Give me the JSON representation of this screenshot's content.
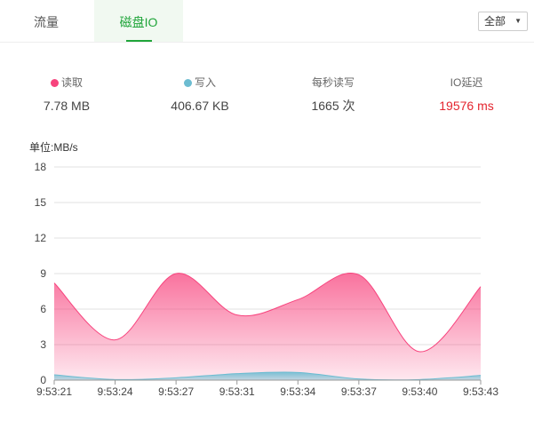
{
  "tabs": {
    "flow": "流量",
    "disk_io": "磁盘IO",
    "active": "disk_io"
  },
  "disk_selector": {
    "value": "全部",
    "caret": "▼"
  },
  "stats": {
    "read": {
      "label": "读取",
      "value": "7.78 MB",
      "color": "#f7437d"
    },
    "write": {
      "label": "写入",
      "value": "406.67 KB",
      "color": "#6cbcd1"
    },
    "iops": {
      "label": "每秒读写",
      "value": "1665 次"
    },
    "latency": {
      "label": "IO延迟",
      "value": "19576 ms",
      "color": "#e4252e"
    }
  },
  "chart_data": {
    "type": "area",
    "ylabel": "单位:MB/s",
    "ylim": [
      0,
      18
    ],
    "yticks": [
      0,
      3,
      6,
      9,
      12,
      15,
      18
    ],
    "x": [
      "9:53:21",
      "9:53:24",
      "9:53:27",
      "9:53:31",
      "9:53:34",
      "9:53:37",
      "9:53:40",
      "9:53:43"
    ],
    "series": [
      {
        "name": "读取",
        "color": "#f7437d",
        "values": [
          8.2,
          3.4,
          9.0,
          5.5,
          6.8,
          8.9,
          2.4,
          7.9
        ]
      },
      {
        "name": "写入",
        "color": "#6cbcd1",
        "values": [
          0.45,
          0.05,
          0.2,
          0.55,
          0.65,
          0.1,
          0.05,
          0.4
        ]
      }
    ],
    "grid": true
  }
}
